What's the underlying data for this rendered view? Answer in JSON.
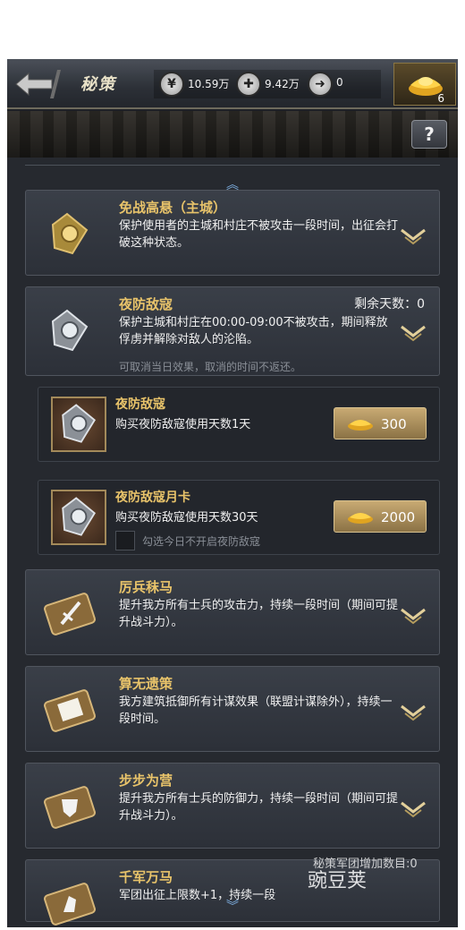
{
  "header": {
    "title": "秘策",
    "resources": [
      {
        "icon": "yuan-token-icon",
        "value": "10.59万"
      },
      {
        "icon": "cross-coin-icon",
        "value": "9.42万"
      },
      {
        "icon": "arrow-coin-icon",
        "value": "0"
      }
    ],
    "gold_count": "6",
    "help_label": "?"
  },
  "items": [
    {
      "title": "免战高悬（主城）",
      "desc": "保护使用者的主城和村庄不被攻击一段时间，出征会打破这种状态。",
      "icon": "gold-shield-badge-icon"
    },
    {
      "title": "夜防敌寇",
      "desc": "保护主城和村庄在00:00-09:00不被攻击，期间释放俘虏并解除对敌人的沦陷。",
      "remain": "剩余天数：0",
      "note": "可取消当日效果，取消的时间不返还。",
      "icon": "silver-shield-badge-icon"
    },
    {
      "title": "厉兵秣马",
      "desc": "提升我方所有士兵的攻击力，持续一段时间（期间可提升战斗力）。",
      "icon": "sword-scroll-icon"
    },
    {
      "title": "算无遗策",
      "desc": "我方建筑抵御所有计谋效果（联盟计谋除外），持续一段时间。",
      "icon": "paper-scroll-icon"
    },
    {
      "title": "步步为营",
      "desc": "提升我方所有士兵的防御力，持续一段时间（期间可提升战斗力）。",
      "icon": "shield-scroll-icon"
    },
    {
      "title": "千军万马",
      "desc": "军团出征上限数+1，持续一段",
      "icon": "horse-scroll-icon"
    }
  ],
  "purchases": [
    {
      "title": "夜防敌寇",
      "desc": "购买夜防敌寇使用天数1天",
      "price": "300"
    },
    {
      "title": "夜防敌寇月卡",
      "desc": "购买夜防敌寇使用天数30天",
      "price": "2000",
      "checkbox_label": "勾选今日不开启夜防敌寇"
    }
  ],
  "watermark": {
    "text": "豌豆荚",
    "overlap_text": "秘策军团增加数目:0"
  },
  "colors": {
    "title_gold": "#e8c36a",
    "accent_blue": "#7fb2e6"
  }
}
